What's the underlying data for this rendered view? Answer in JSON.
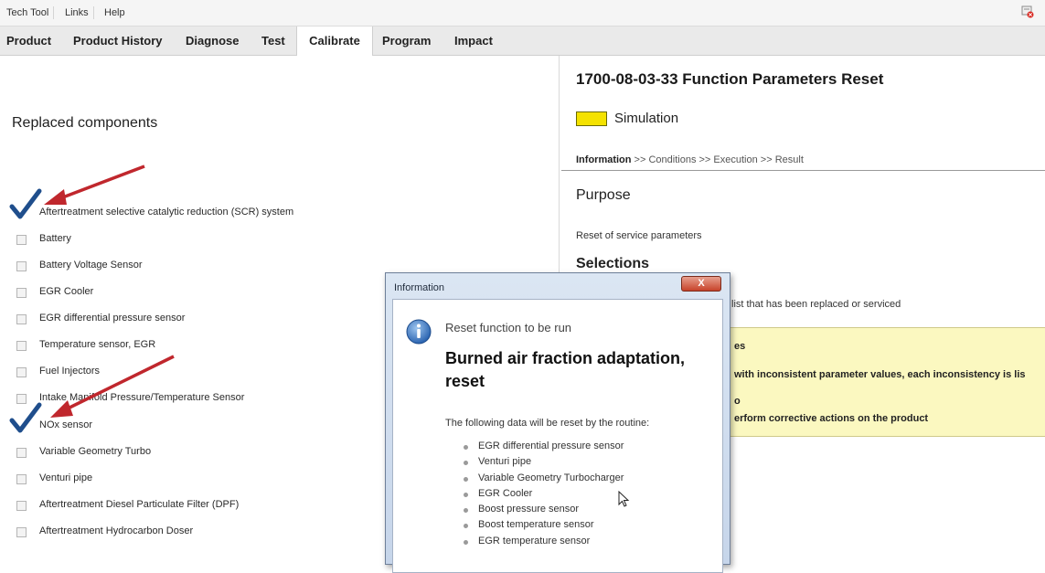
{
  "menu": [
    "Tech Tool",
    "Links",
    "Help"
  ],
  "tabs": [
    "Product",
    "Product History",
    "Diagnose",
    "Test",
    "Calibrate",
    "Program",
    "Impact"
  ],
  "active_tab": "Calibrate",
  "left_pane": {
    "section_title": "Replaced components",
    "components": [
      {
        "label": "Aftertreatment selective catalytic reduction (SCR) system",
        "checked": true
      },
      {
        "label": "Battery",
        "checked": false
      },
      {
        "label": "Battery Voltage Sensor",
        "checked": false
      },
      {
        "label": "EGR Cooler",
        "checked": false
      },
      {
        "label": "EGR differential pressure sensor",
        "checked": false
      },
      {
        "label": "Temperature sensor, EGR",
        "checked": false
      },
      {
        "label": "Fuel Injectors",
        "checked": false
      },
      {
        "label": "Intake Manifold Pressure/Temperature Sensor",
        "checked": false
      },
      {
        "label": "NOx sensor",
        "checked": true
      },
      {
        "label": "Variable Geometry Turbo",
        "checked": false
      },
      {
        "label": "Venturi pipe",
        "checked": false
      },
      {
        "label": "Aftertreatment Diesel Particulate Filter (DPF)",
        "checked": false
      },
      {
        "label": "Aftertreatment Hydrocarbon Doser",
        "checked": false
      }
    ]
  },
  "right_pane": {
    "function_title": "1700-08-03-33 Function Parameters Reset",
    "status_label": "Simulation",
    "status_color": "#f4e200",
    "steps": {
      "current": "Information",
      "sep": " >> ",
      "rest": [
        "Conditions",
        "Execution",
        "Result"
      ]
    },
    "purpose_heading": "Purpose",
    "purpose_text": "Reset of service parameters",
    "selections_heading": "Selections",
    "selections_text": "list that has been replaced or serviced",
    "note_lines": [
      "es",
      "with inconsistent parameter values, each inconsistency is lis",
      "o",
      "erform corrective actions on the product"
    ]
  },
  "dialog": {
    "title": "Information",
    "close_glyph": "X",
    "subtitle": "Reset function to be run",
    "heading": "Burned air fraction adaptation, reset",
    "intro": "The following data will be reset by the routine:",
    "items": [
      "EGR differential pressure sensor",
      "Venturi pipe",
      "Variable Geometry Turbocharger",
      "EGR Cooler",
      "Boost pressure sensor",
      "Boost temperature sensor",
      "EGR temperature sensor"
    ]
  },
  "colors": {
    "checkmark": "#1f4e8c",
    "annotation_arrow": "#c0272d",
    "dialog_close": "#c7432a"
  },
  "icons": [
    "close-tool-icon",
    "info-icon",
    "checkmark-icon",
    "red-arrow-annotation",
    "mouse-cursor-icon"
  ]
}
